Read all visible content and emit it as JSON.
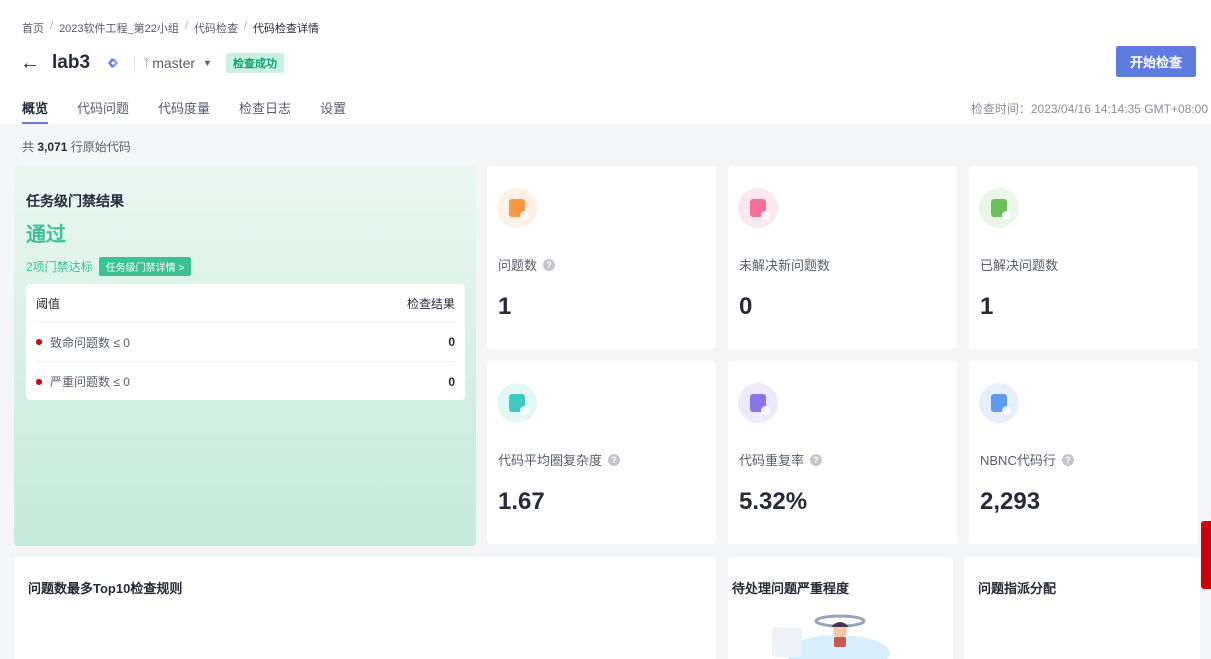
{
  "breadcrumb": [
    "首页",
    "2023软件工程_第22小组",
    "代码检查",
    "代码检查详情"
  ],
  "project": {
    "title": "lab3",
    "branch": "master",
    "status": "检查成功"
  },
  "actions": {
    "start_label": "开始检查"
  },
  "tabs": [
    {
      "label": "概览",
      "active": true
    },
    {
      "label": "代码问题",
      "active": false
    },
    {
      "label": "代码度量",
      "active": false
    },
    {
      "label": "检查日志",
      "active": false
    },
    {
      "label": "设置",
      "active": false
    }
  ],
  "check_time": "检查时间：2023/04/16 14:14:35 GMT+08:00",
  "lines": {
    "prefix": "共 ",
    "count": "3,071",
    "suffix": " 行原始代码"
  },
  "gate": {
    "title": "任务级门禁结果",
    "result": "通过",
    "count_text": "2项门禁达标",
    "detail_label": "任务级门禁详情 >",
    "table_head": {
      "threshold": "阈值",
      "result": "检查结果"
    },
    "rows": [
      {
        "label": "致命问题数 ≤ 0",
        "value": "0"
      },
      {
        "label": "严重问题数 ≤ 0",
        "value": "0"
      }
    ]
  },
  "metrics": [
    {
      "label": "问题数",
      "value": "1",
      "help": true,
      "icon": "issue-icon",
      "bg": "#fff1e6",
      "fg": "#fa9841"
    },
    {
      "label": "未解决新问题数",
      "value": "0",
      "help": false,
      "icon": "new-issue-icon",
      "bg": "#fde8f0",
      "fg": "#f66f9a"
    },
    {
      "label": "已解决问题数",
      "value": "1",
      "help": false,
      "icon": "resolved-icon",
      "bg": "#e8f7e8",
      "fg": "#6cbf5c"
    },
    {
      "label": "代码平均圈复杂度",
      "value": "1.67",
      "help": true,
      "icon": "complexity-icon",
      "bg": "#e3f8f6",
      "fg": "#3dcbbf"
    },
    {
      "label": "代码重复率",
      "value": "5.32%",
      "help": true,
      "icon": "duplication-icon",
      "bg": "#eeeafc",
      "fg": "#8a75e8"
    },
    {
      "label": "NBNC代码行",
      "value": "2,293",
      "help": true,
      "icon": "code-lines-icon",
      "bg": "#e6f0fd",
      "fg": "#5b9bf0"
    }
  ],
  "bottom": {
    "top10": "问题数最多Top10检查规则",
    "severity": "待处理问题严重程度",
    "assign": "问题指派分配"
  },
  "colors": {
    "primary": "#5e7ce0",
    "success": "#3ac295",
    "danger": "#c7000b"
  }
}
